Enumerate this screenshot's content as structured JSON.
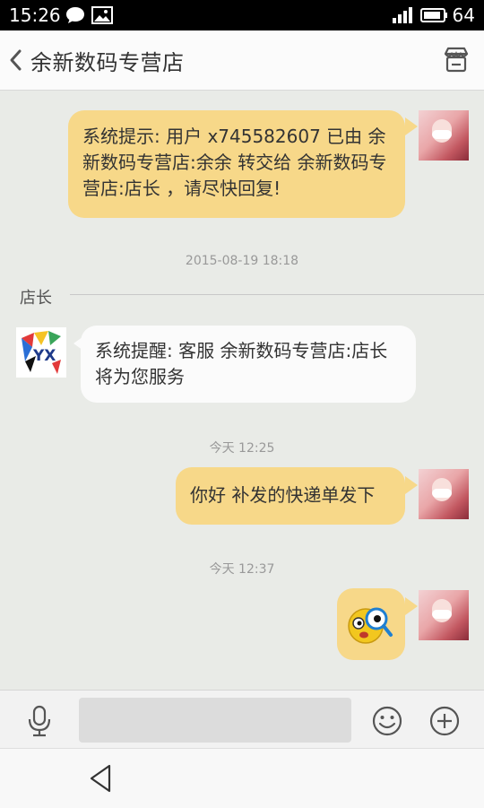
{
  "status_bar": {
    "time": "15:26",
    "battery": "64",
    "icons": [
      "chat-notification-icon",
      "image-notification-icon",
      "signal-icon",
      "battery-icon"
    ]
  },
  "header": {
    "title": "余新数码专营店",
    "back_icon": "chevron-left-icon",
    "store_icon": "store-icon"
  },
  "messages": [
    {
      "from": "me",
      "text": "系统提示: 用户 x745582607 已由 余新数码专营店:余余 转交给 余新数码专营店:店长 ，请尽快回复!"
    },
    {
      "timestamp": "2015-08-19 18:18"
    },
    {
      "divider": "店长"
    },
    {
      "from": "shop",
      "avatar_label": "YX",
      "text": "系统提醒: 客服 余新数码专营店:店长 将为您服务"
    },
    {
      "timestamp": "今天 12:25"
    },
    {
      "from": "me",
      "text": "你好 补发的快递单发下"
    },
    {
      "timestamp": "今天 12:37"
    },
    {
      "from": "me",
      "sticker": "surprised-emoji-sticker"
    }
  ],
  "input_bar": {
    "mic_icon": "microphone-icon",
    "emoji_icon": "smiley-icon",
    "plus_icon": "plus-icon",
    "text_value": ""
  },
  "nav_bar": {
    "back_icon": "back-triangle-icon"
  },
  "colors": {
    "my_bubble": "#f7d889",
    "other_bubble": "#fbfbfb",
    "chat_background": "#e9ebe7"
  }
}
